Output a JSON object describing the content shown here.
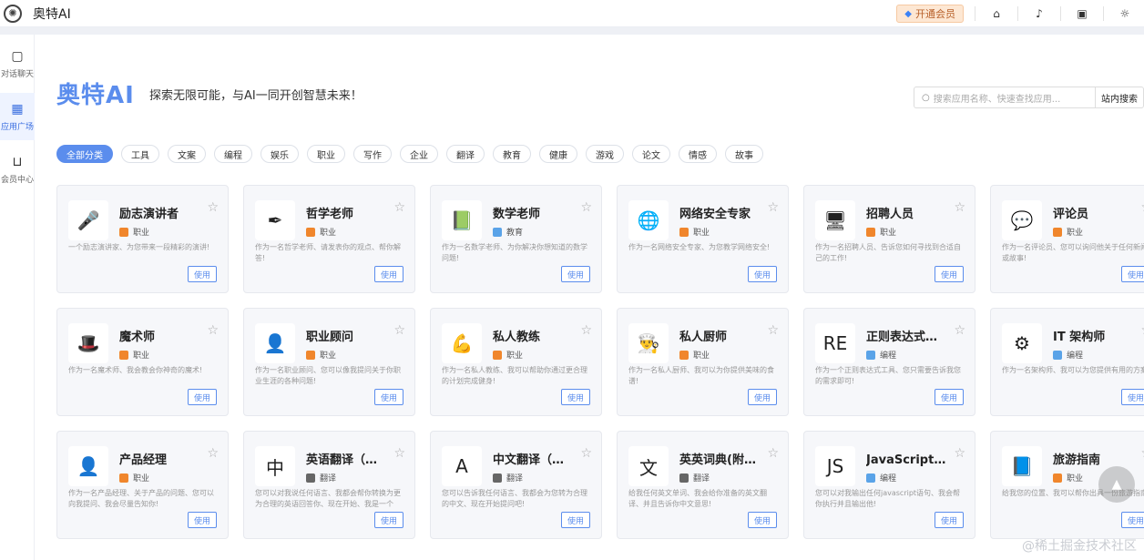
{
  "app": {
    "title": "奥特AI"
  },
  "topbar": {
    "vip_label": "开通会员"
  },
  "sidebar": {
    "items": [
      {
        "label": "对话聊天",
        "icon": "chat-icon"
      },
      {
        "label": "应用广场",
        "icon": "grid-icon"
      },
      {
        "label": "会员中心",
        "icon": "cart-icon"
      }
    ]
  },
  "hero": {
    "title": "奥特AI",
    "subtitle": "探索无限可能，与AI一同开创智慧未来！"
  },
  "search": {
    "placeholder": "搜索应用名称、快速查找应用...",
    "button": "站内搜索"
  },
  "categories": [
    "全部分类",
    "工具",
    "文案",
    "编程",
    "娱乐",
    "职业",
    "写作",
    "企业",
    "翻译",
    "教育",
    "健康",
    "游戏",
    "论文",
    "情感",
    "故事"
  ],
  "use_label": "使用",
  "cards": [
    {
      "name": "励志演讲者",
      "tag": "职业",
      "desc": "一个励志演讲家、为您带来一段精彩的演讲!"
    },
    {
      "name": "哲学老师",
      "tag": "职业",
      "desc": "作为一名哲学老师、请发表你的观点、帮你解答!"
    },
    {
      "name": "数学老师",
      "tag": "教育",
      "desc": "作为一名数学老师、为你解决你想知道的数学问题!"
    },
    {
      "name": "网络安全专家",
      "tag": "职业",
      "desc": "作为一名网络安全专家、为您教学网络安全!"
    },
    {
      "name": "招聘人员",
      "tag": "职业",
      "desc": "作为一名招聘人员、告诉您如何寻找到合适自己的工作!"
    },
    {
      "name": "评论员",
      "tag": "职业",
      "desc": "作为一名评论员、您可以询问他关于任何新闻或故事!"
    },
    {
      "name": "魔术师",
      "tag": "职业",
      "desc": "作为一名魔术师、我会教会你神奇的魔术!"
    },
    {
      "name": "职业顾问",
      "tag": "职业",
      "desc": "作为一名职业顾问、您可以像我提问关于你职业生涯的各种问题!"
    },
    {
      "name": "私人教练",
      "tag": "职业",
      "desc": "作为一名私人教练、我可以帮助你通过更合理的计划完成健身!"
    },
    {
      "name": "私人厨师",
      "tag": "职业",
      "desc": "作为一名私人厨师、我可以为你提供美味的食谱!"
    },
    {
      "name": "正则表达式生...",
      "tag": "编程",
      "desc": "作为一个正则表达式工具、您只需要告诉我您的需求即可!"
    },
    {
      "name": "IT 架构师",
      "tag": "编程",
      "desc": "作为一名架构师、我可以为您提供有用的方案!"
    },
    {
      "name": "产品经理",
      "tag": "职业",
      "desc": "作为一名产品经理、关于产品的问题、您可以向我提问、我会尽量告知你!"
    },
    {
      "name": "英语翻译（中...",
      "tag": "翻译",
      "desc": "您可以对我说任何语言、我都会帮你转换为更为合理的英语回答你、现在开始、我是一个英..."
    },
    {
      "name": "中文翻译（英...",
      "tag": "翻译",
      "desc": "您可以告诉我任何语言、我都会为您转为合理的中文、现在开始提问吧!"
    },
    {
      "name": "英英词典(附中...",
      "tag": "翻译",
      "desc": "给我任何英文单词、我会给你准备的英文翻译、并且告诉你中文意思!"
    },
    {
      "name": "JavaScript 控...",
      "tag": "编程",
      "desc": "您可以对我输出任何javascript语句、我会帮你执行并且输出他!"
    },
    {
      "name": "旅游指南",
      "tag": "职业",
      "desc": "给我您的位置、我可以帮你出具一份旅游指南!"
    }
  ],
  "watermark": "@稀土掘金技术社区"
}
